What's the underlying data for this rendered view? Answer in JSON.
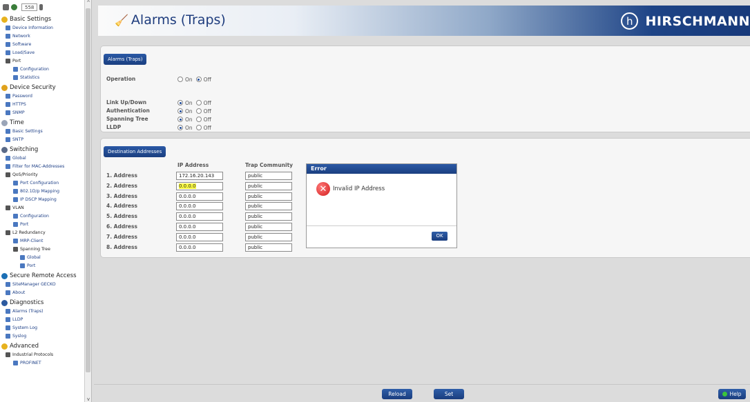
{
  "sidebar": {
    "counter": "558",
    "groups": [
      {
        "label": "Basic Settings",
        "icon": "star-icon",
        "items": [
          {
            "label": "Device Information",
            "icon": "info-icon",
            "level": 1
          },
          {
            "label": "Network",
            "icon": "globe-icon",
            "level": 1
          },
          {
            "label": "Software",
            "icon": "software-icon",
            "level": 1
          },
          {
            "label": "Load/Save",
            "icon": "save-icon",
            "level": 1
          },
          {
            "label": "Port",
            "icon": "port-icon",
            "level": 1,
            "plain": true
          },
          {
            "label": "Configuration",
            "icon": "port-icon",
            "level": 2
          },
          {
            "label": "Statistics",
            "icon": "statistics-icon",
            "level": 2
          }
        ]
      },
      {
        "label": "Device Security",
        "icon": "lock-icon",
        "items": [
          {
            "label": "Password",
            "icon": "password-icon",
            "level": 1
          },
          {
            "label": "HTTPS",
            "icon": "https-icon",
            "level": 1
          },
          {
            "label": "SNMP",
            "icon": "snmp-icon",
            "level": 1
          }
        ]
      },
      {
        "label": "Time",
        "icon": "clock-icon",
        "items": [
          {
            "label": "Basic Settings",
            "icon": "clock-icon",
            "level": 1
          },
          {
            "label": "SNTP",
            "icon": "sntp-icon",
            "level": 1
          }
        ]
      },
      {
        "label": "Switching",
        "icon": "switching-icon",
        "items": [
          {
            "label": "Global",
            "icon": "global-icon",
            "level": 1
          },
          {
            "label": "Filter for MAC-Addresses",
            "icon": "filter-icon",
            "level": 1
          },
          {
            "label": "QoS/Priority",
            "icon": "qos-icon",
            "level": 1,
            "plain": true
          },
          {
            "label": "Port Configuration",
            "icon": "port-icon",
            "level": 2
          },
          {
            "label": "802.1D/p Mapping",
            "icon": "table-icon",
            "level": 2
          },
          {
            "label": "IP DSCP Mapping",
            "icon": "table-icon",
            "level": 2
          },
          {
            "label": "VLAN",
            "icon": "vlan-icon",
            "level": 1,
            "plain": true
          },
          {
            "label": "Configuration",
            "icon": "table-icon",
            "level": 2
          },
          {
            "label": "Port",
            "icon": "port-icon",
            "level": 2
          },
          {
            "label": "L2 Redundancy",
            "icon": "redundancy-icon",
            "level": 1,
            "plain": true
          },
          {
            "label": "MRP-Client",
            "icon": "mrp-icon",
            "level": 2
          },
          {
            "label": "Spanning Tree",
            "icon": "spanning-tree-icon",
            "level": 2,
            "plain": true
          },
          {
            "label": "Global",
            "icon": "global-icon",
            "level": 3
          },
          {
            "label": "Port",
            "icon": "port-icon",
            "level": 3
          }
        ]
      },
      {
        "label": "Secure Remote Access",
        "icon": "remote-access-icon",
        "items": [
          {
            "label": "SiteManager GECKO",
            "icon": "sitemanager-icon",
            "level": 1
          },
          {
            "label": "About",
            "icon": "about-icon",
            "level": 1
          }
        ]
      },
      {
        "label": "Diagnostics",
        "icon": "diagnostics-icon",
        "items": [
          {
            "label": "Alarms (Traps)",
            "icon": "alarm-icon",
            "level": 1
          },
          {
            "label": "LLDP",
            "icon": "lldp-icon",
            "level": 1
          },
          {
            "label": "System Log",
            "icon": "log-icon",
            "level": 1
          },
          {
            "label": "Syslog",
            "icon": "syslog-icon",
            "level": 1
          }
        ]
      },
      {
        "label": "Advanced",
        "icon": "advanced-icon",
        "items": [
          {
            "label": "Industrial Protocols",
            "icon": "protocol-icon",
            "level": 1,
            "plain": true
          },
          {
            "label": "PROFINET",
            "icon": "profinet-icon",
            "level": 2
          }
        ]
      }
    ]
  },
  "header": {
    "title": "Alarms (Traps)",
    "brand": "HIRSCHMANN"
  },
  "alarms_panel": {
    "tab": "Alarms (Traps)",
    "rows": [
      {
        "label": "Operation",
        "value": "off"
      },
      {
        "label": "Link Up/Down",
        "value": "on"
      },
      {
        "label": "Authentication",
        "value": "on"
      },
      {
        "label": "Spanning Tree",
        "value": "on"
      },
      {
        "label": "LLDP",
        "value": "on"
      }
    ],
    "on_label": "On",
    "off_label": "Off"
  },
  "destinations_panel": {
    "tab": "Destination Addresses",
    "col_ip": "IP Address",
    "col_community": "Trap Community",
    "rows": [
      {
        "label": "1. Address",
        "ip": "172.16.20.143",
        "community": "public"
      },
      {
        "label": "2. Address",
        "ip": "0.0.0.0",
        "community": "public",
        "invalid": true
      },
      {
        "label": "3. Address",
        "ip": "0.0.0.0",
        "community": "public"
      },
      {
        "label": "4. Address",
        "ip": "0.0.0.0",
        "community": "public"
      },
      {
        "label": "5. Address",
        "ip": "0.0.0.0",
        "community": "public"
      },
      {
        "label": "6. Address",
        "ip": "0.0.0.0",
        "community": "public"
      },
      {
        "label": "7. Address",
        "ip": "0.0.0.0",
        "community": "public"
      },
      {
        "label": "8. Address",
        "ip": "0.0.0.0",
        "community": "public"
      }
    ]
  },
  "dialog": {
    "title": "Error",
    "message": "Invalid IP Address",
    "ok": "OK"
  },
  "footer": {
    "reload": "Reload",
    "set": "Set",
    "help": "Help"
  }
}
